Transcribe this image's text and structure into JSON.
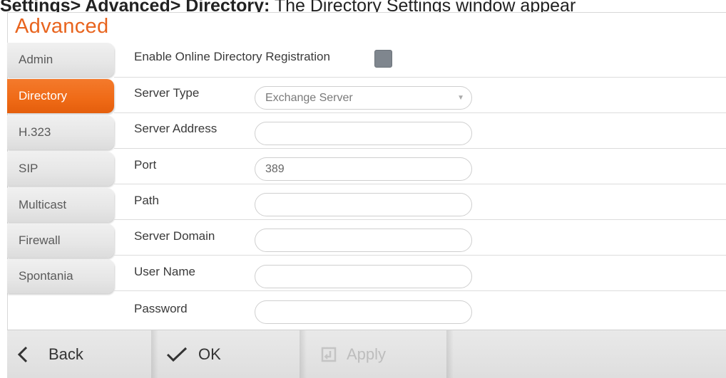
{
  "caption": {
    "bold_text": "Settings> Advanced> Directory:",
    "normal_text": " The Directory Settings window appear"
  },
  "section": {
    "title": "Advanced"
  },
  "sidebar": {
    "items": [
      {
        "label": "Admin",
        "active": false
      },
      {
        "label": "Directory",
        "active": true
      },
      {
        "label": "H.323",
        "active": false
      },
      {
        "label": "SIP",
        "active": false
      },
      {
        "label": "Multicast",
        "active": false
      },
      {
        "label": "Firewall",
        "active": false
      },
      {
        "label": "Spontania",
        "active": false
      }
    ]
  },
  "form": {
    "enable_registration": {
      "label": "Enable Online Directory Registration",
      "checked": false
    },
    "server_type": {
      "label": "Server Type",
      "value": "Exchange Server"
    },
    "server_address": {
      "label": "Server Address",
      "value": ""
    },
    "port": {
      "label": "Port",
      "value": "389"
    },
    "path": {
      "label": "Path",
      "value": ""
    },
    "server_domain": {
      "label": "Server Domain",
      "value": ""
    },
    "user_name": {
      "label": "User Name",
      "value": ""
    },
    "password": {
      "label": "Password",
      "value": ""
    }
  },
  "footer": {
    "back_label": "Back",
    "ok_label": "OK",
    "apply_label": "Apply"
  },
  "icons": {
    "back": "chevron-left-icon",
    "ok": "checkmark-icon",
    "apply": "apply-icon",
    "dropdown": "dropdown-caret-icon"
  },
  "colors": {
    "accent": "#ef6a16",
    "checkbox": "#7f868e",
    "disabled_text": "#bdbdbd"
  }
}
